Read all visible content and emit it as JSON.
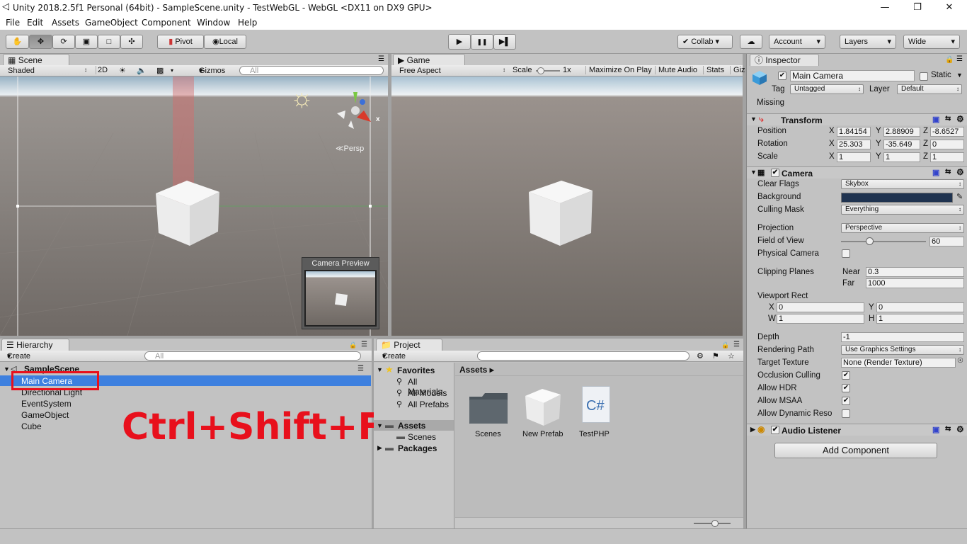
{
  "window": {
    "title": "Unity 2018.2.5f1 Personal (64bit) - SampleScene.unity - TestWebGL - WebGL <DX11 on DX9 GPU>",
    "minimize_icon": "—",
    "restore_icon": "❐",
    "close_icon": "✕"
  },
  "menu": [
    "File",
    "Edit",
    "Assets",
    "GameObject",
    "Component",
    "Window",
    "Help"
  ],
  "toolbar": {
    "pivot": "Pivot",
    "local": "Local",
    "collab": "Collab",
    "account": "Account",
    "layers": "Layers",
    "layout": "Wide",
    "play_icon": "▶",
    "pause_icon": "❚❚",
    "step_icon": "▶▌"
  },
  "scene": {
    "tab": "Scene",
    "shading": "Shaded",
    "mode2d": "2D",
    "gizmos": "Gizmos",
    "search_placeholder": "All",
    "persp": "Persp",
    "axis_x": "x",
    "camera_preview": "Camera Preview"
  },
  "game": {
    "tab": "Game",
    "aspect": "Free Aspect",
    "scale_label": "Scale",
    "scale_value": "1x",
    "maximize": "Maximize On Play",
    "mute": "Mute Audio",
    "stats": "Stats",
    "gizmos": "Giz"
  },
  "inspector": {
    "tab": "Inspector",
    "object_name": "Main Camera",
    "static_label": "Static",
    "tag_label": "Tag",
    "tag_value": "Untagged",
    "layer_label": "Layer",
    "layer_value": "Default",
    "missing": "Missing",
    "transform": {
      "title": "Transform",
      "position_label": "Position",
      "rotation_label": "Rotation",
      "scale_label": "Scale",
      "axis_x": "X",
      "axis_y": "Y",
      "axis_z": "Z",
      "position": [
        "1.84154",
        "2.88909",
        "-8.6527"
      ],
      "rotation": [
        "25.303",
        "-35.649",
        "0"
      ],
      "scale": [
        "1",
        "1",
        "1"
      ]
    },
    "camera": {
      "title": "Camera",
      "clear_flags_label": "Clear Flags",
      "clear_flags": "Skybox",
      "background_label": "Background",
      "background_color": "#1f3350",
      "culling_mask_label": "Culling Mask",
      "culling_mask": "Everything",
      "projection_label": "Projection",
      "projection": "Perspective",
      "fov_label": "Field of View",
      "fov": "60",
      "fov_fraction": 0.33,
      "physical_label": "Physical Camera",
      "clipping_label": "Clipping Planes",
      "near_label": "Near",
      "near": "0.3",
      "far_label": "Far",
      "far": "1000",
      "viewport_label": "Viewport Rect",
      "vp_x_label": "X",
      "vp_x": "0",
      "vp_y_label": "Y",
      "vp_y": "0",
      "vp_w_label": "W",
      "vp_w": "1",
      "vp_h_label": "H",
      "vp_h": "1",
      "depth_label": "Depth",
      "depth": "-1",
      "rendering_path_label": "Rendering Path",
      "rendering_path": "Use Graphics Settings",
      "target_texture_label": "Target Texture",
      "target_texture": "None (Render Texture)",
      "occlusion_label": "Occlusion Culling",
      "hdr_label": "Allow HDR",
      "msaa_label": "Allow MSAA",
      "dynres_label": "Allow Dynamic Reso",
      "check": "✔"
    },
    "audio_listener": "Audio Listener",
    "add_component": "Add Component"
  },
  "hierarchy": {
    "tab": "Hierarchy",
    "create": "Create",
    "search_placeholder": "All",
    "scene_name": "SampleScene",
    "items": [
      "Main Camera",
      "Directional Light",
      "EventSystem",
      "GameObject",
      "Cube"
    ]
  },
  "project": {
    "tab": "Project",
    "create": "Create",
    "favorites": "Favorites",
    "fav_items": [
      "All Materials",
      "All Models",
      "All Prefabs"
    ],
    "assets": "Assets",
    "scenes": "Scenes",
    "packages": "Packages",
    "breadcrumb": "Assets",
    "files": [
      {
        "name": "Scenes",
        "icon": "folder-icon"
      },
      {
        "name": "New Prefab",
        "icon": "prefab-icon"
      },
      {
        "name": "TestPHP",
        "icon": "csharp-script-icon"
      }
    ],
    "csharp_glyph": "C#"
  },
  "overlay_caption": "Ctrl+Shift+F",
  "colors": {
    "selection": "#3d80df",
    "highlight_box": "#e8101c",
    "caption": "#e8101c"
  }
}
